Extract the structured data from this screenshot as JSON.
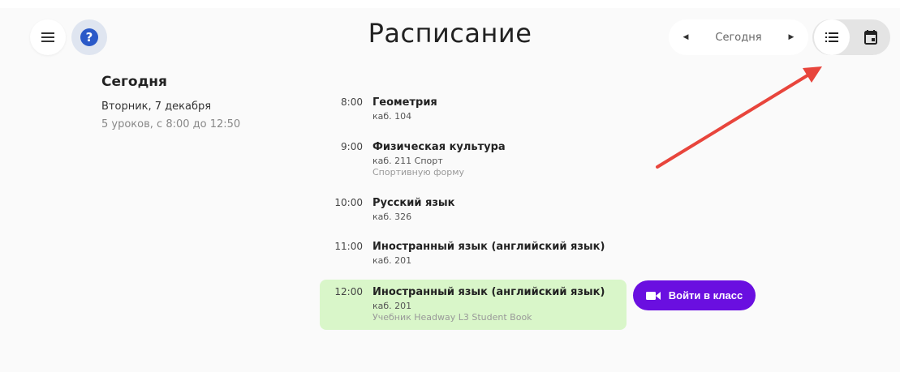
{
  "header": {
    "title": "Расписание",
    "date_nav": {
      "prev_icon": "caret-left-icon",
      "label": "Сегодня",
      "next_icon": "caret-right-icon"
    },
    "view_switch": {
      "list_icon": "list-view-icon",
      "calendar_icon": "calendar-view-icon",
      "selected": "list"
    },
    "menu_icon": "hamburger-menu-icon",
    "help_icon": "help-icon",
    "help_glyph": "?"
  },
  "day": {
    "heading": "Сегодня",
    "date": "Вторник,  7 декабря",
    "summary": "5 уроков, с 8:00 до 12:50"
  },
  "lessons": [
    {
      "time": "8:00",
      "name": "Геометрия",
      "room": "каб. 104",
      "note": ""
    },
    {
      "time": "9:00",
      "name": "Физическая культура",
      "room": "каб. 211 Спорт",
      "note": "Спортивную форму"
    },
    {
      "time": "10:00",
      "name": "Русский язык",
      "room": "каб. 326",
      "note": ""
    },
    {
      "time": "11:00",
      "name": "Иностранный язык (английский язык)",
      "room": "каб. 201",
      "note": ""
    },
    {
      "time": "12:00",
      "name": "Иностранный язык (английский язык)",
      "room": "каб. 201",
      "note": "Учебник Headway L3 Student Book"
    }
  ],
  "join_button": {
    "label": "Войти в класс",
    "icon": "video-camera-icon"
  },
  "colors": {
    "accent": "#6a0fe0",
    "current_lesson_bg": "#d9f6c9",
    "help_blue": "#2a59c8",
    "annotation_arrow": "#e8453c"
  }
}
